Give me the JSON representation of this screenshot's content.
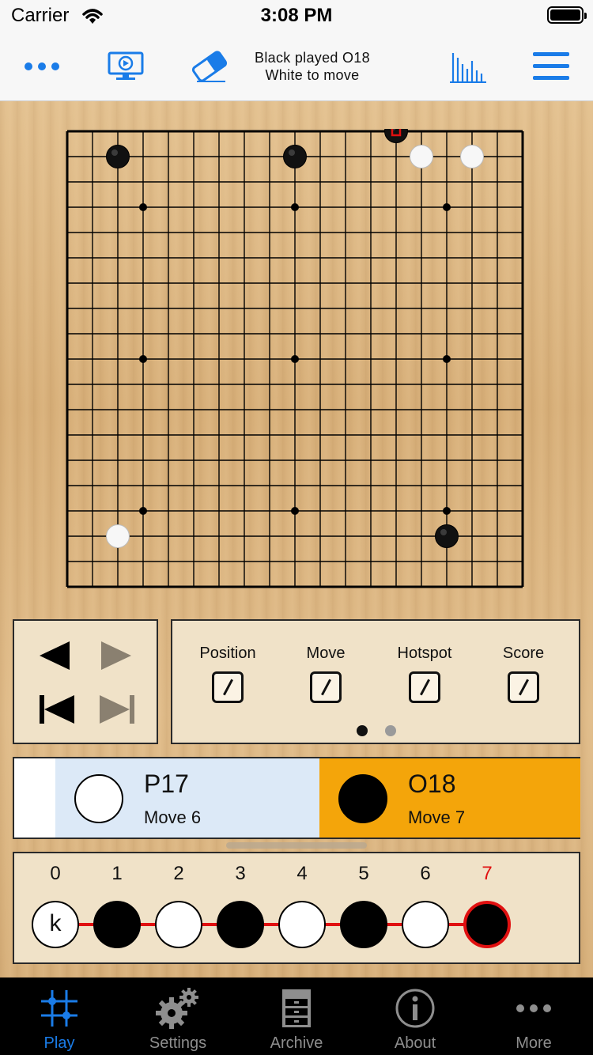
{
  "status_bar": {
    "carrier": "Carrier",
    "time": "3:08 PM"
  },
  "nav": {
    "status_line1": "Black played O18",
    "status_line2": "White to move",
    "icons": [
      "more-icon",
      "screen-play-icon",
      "eraser-icon",
      "chart-icon",
      "menu-icon"
    ]
  },
  "board": {
    "size": 19,
    "black_stones": [
      "C18",
      "K18",
      "O19",
      "Q3"
    ],
    "white_stones": [
      "P18",
      "R18",
      "C3"
    ],
    "last_move": "O19",
    "colors": {
      "board_line": "#000000",
      "last_move_marker": "#e01010"
    }
  },
  "options": {
    "items": [
      {
        "label": "Position"
      },
      {
        "label": "Move"
      },
      {
        "label": "Hotspot"
      },
      {
        "label": "Score"
      }
    ],
    "page": 1,
    "pages": 2
  },
  "players": {
    "white": {
      "name": "P17",
      "move": "Move 6"
    },
    "black": {
      "name": "O18",
      "move": "Move 7"
    },
    "colors": {
      "white_bg": "#dce9f7",
      "black_bg": "#f4a50a"
    }
  },
  "history": {
    "numbers": [
      "0",
      "1",
      "2",
      "3",
      "4",
      "5",
      "6",
      "7"
    ],
    "start_label": "k",
    "stones": [
      "white-k",
      "black",
      "white",
      "black",
      "white",
      "black",
      "white",
      "black"
    ],
    "current_index": 7,
    "colors": {
      "current": "#e01010",
      "link": "#e01010"
    }
  },
  "tabs": [
    {
      "label": "Play",
      "icon": "play-grid-icon",
      "active": true
    },
    {
      "label": "Settings",
      "icon": "gears-icon",
      "active": false
    },
    {
      "label": "Archive",
      "icon": "cabinet-icon",
      "active": false
    },
    {
      "label": "About",
      "icon": "info-icon",
      "active": false
    },
    {
      "label": "More",
      "icon": "more-icon",
      "active": false
    }
  ],
  "accent": "#1a7ce8"
}
